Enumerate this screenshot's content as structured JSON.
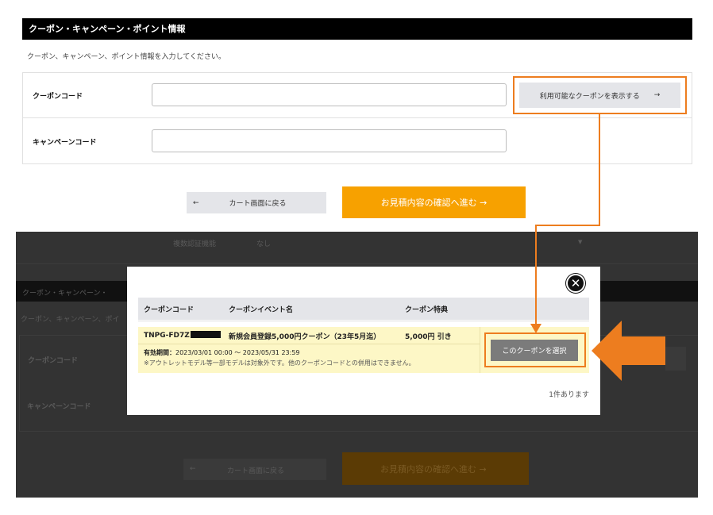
{
  "section": {
    "title": "クーポン・キャンペーン・ポイント情報",
    "description": "クーポン、キャンペーン、ポイント情報を入力してください。",
    "coupon_label": "クーポンコード",
    "coupon_value": "",
    "campaign_label": "キャンペーンコード",
    "campaign_value": "",
    "show_coupons_button": "利用可能なクーポンを表示する",
    "show_coupons_arrow": "→",
    "back_arrow": "←",
    "back_button": "カート画面に戻る",
    "next_button": "お見積内容の確認へ進む →"
  },
  "background": {
    "auth_label": "複数認証機能",
    "auth_value": "なし",
    "title_partial": "クーポン・キャンペーン・",
    "desc_partial": "クーポン、キャンペーン、ポイ",
    "coupon_label": "クーポンコード",
    "campaign_label": "キャンペーンコード",
    "back_button": "カート画面に戻る",
    "next_button": "お見積内容の確認へ進む →",
    "dropdown_arrow": "▼"
  },
  "modal": {
    "close_icon": "✕",
    "columns": [
      "クーポンコード",
      "クーポンイベント名",
      "クーポン特典"
    ],
    "row": {
      "code": "TNPG-FD7Z",
      "event": "新規会員登録5,000円クーポン（23年5月迄）",
      "benefit": "5,000円 引き",
      "validity_label": "有効期間：",
      "validity": "2023/03/01 00:00 ～ 2023/05/31 23:59",
      "note": "※アウトレットモデル等一部モデルは対象外です。他のクーポンコードとの併用はできません。",
      "select_button": "このクーポンを選択"
    },
    "count": "1件あります"
  },
  "colors": {
    "accent_orange": "#ed7d1f",
    "primary_button": "#f7a100",
    "header_bg": "#000000",
    "row_highlight": "#fdf7c6"
  }
}
